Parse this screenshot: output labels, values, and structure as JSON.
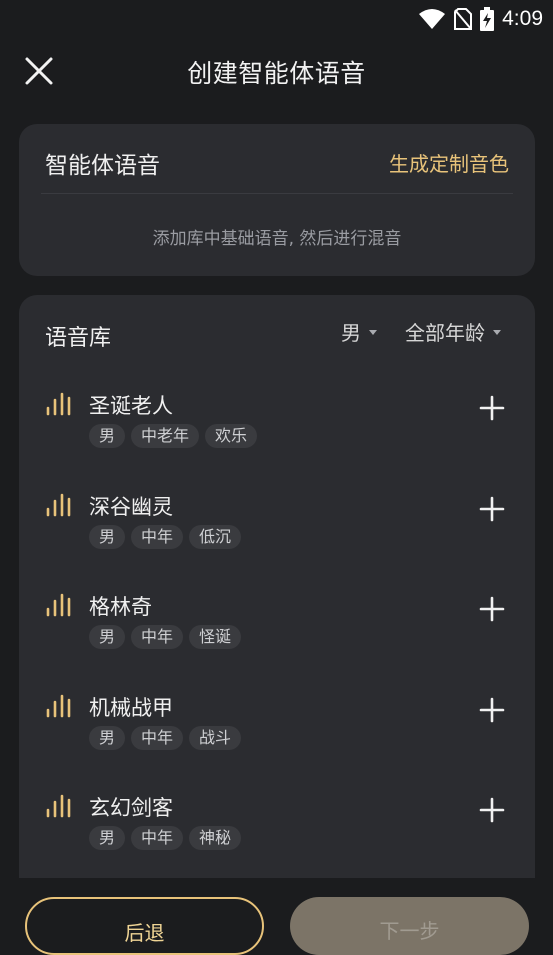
{
  "status_bar": {
    "time": "4:09",
    "icons": [
      "wifi-icon",
      "no-sim-icon",
      "battery-charging-icon"
    ]
  },
  "header": {
    "title": "创建智能体语音",
    "close_icon": "close-icon"
  },
  "agent_voice_card": {
    "title": "智能体语音",
    "custom_link": "生成定制音色",
    "hint": "添加库中基础语音, 然后进行混音"
  },
  "library": {
    "title": "语音库",
    "filter_gender": "男",
    "filter_age": "全部年龄",
    "voices": [
      {
        "name": "圣诞老人",
        "tags": [
          "男",
          "中老年",
          "欢乐"
        ]
      },
      {
        "name": "深谷幽灵",
        "tags": [
          "男",
          "中年",
          "低沉"
        ]
      },
      {
        "name": "格林奇",
        "tags": [
          "男",
          "中年",
          "怪诞"
        ]
      },
      {
        "name": "机械战甲",
        "tags": [
          "男",
          "中年",
          "战斗"
        ]
      },
      {
        "name": "玄幻剑客",
        "tags": [
          "男",
          "中年",
          "神秘"
        ]
      }
    ]
  },
  "footer": {
    "back_label": "后退",
    "next_label": "下一步"
  },
  "colors": {
    "accent": "#e8c37a",
    "card": "#2b2c30",
    "background": "#1b1c1e"
  }
}
